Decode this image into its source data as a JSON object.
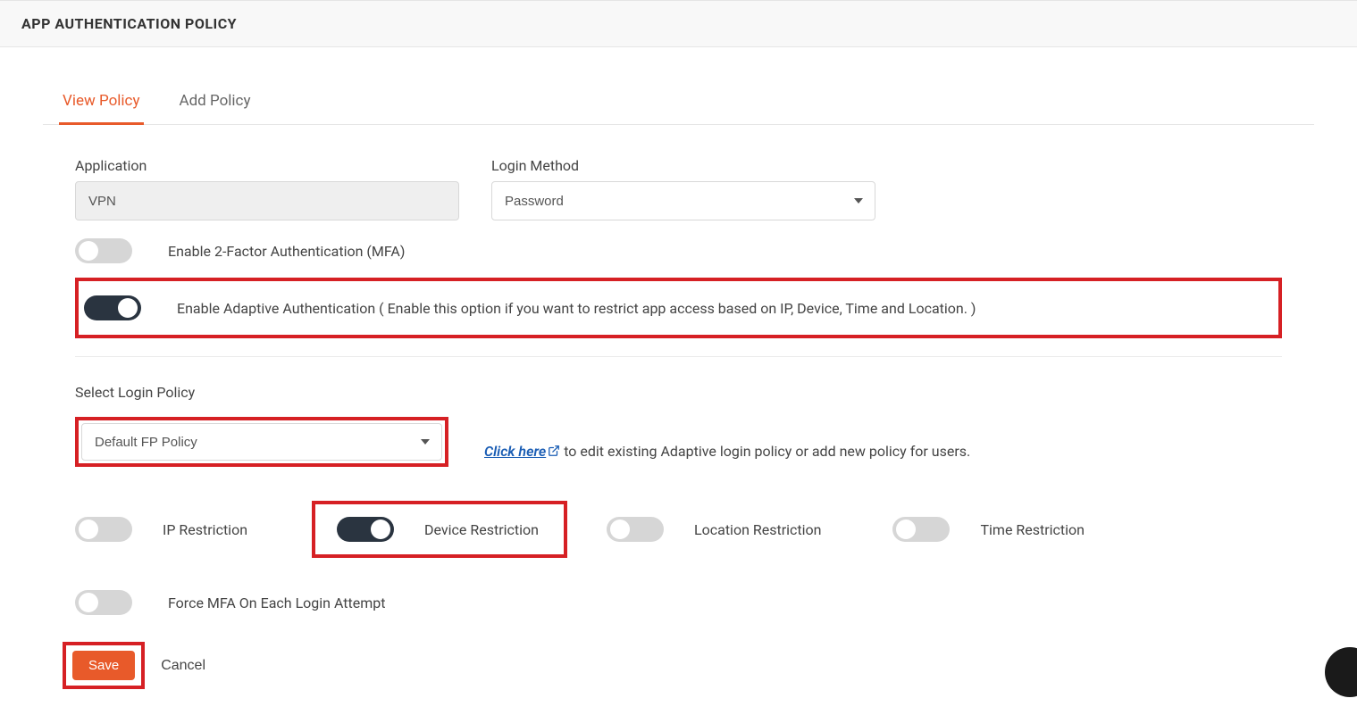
{
  "header": {
    "title": "APP AUTHENTICATION POLICY"
  },
  "tabs": {
    "view": "View Policy",
    "add": "Add Policy"
  },
  "fields": {
    "application_label": "Application",
    "application_value": "VPN",
    "login_method_label": "Login Method",
    "login_method_value": "Password",
    "mfa_toggle_label": "Enable 2-Factor Authentication (MFA)",
    "adaptive_toggle_label": "Enable Adaptive Authentication ( Enable this option if you want to restrict app access based on IP, Device, Time and Location. )",
    "select_login_policy_label": "Select Login Policy",
    "select_login_policy_value": "Default FP Policy",
    "click_here_link": "Click here",
    "click_here_rest": " to edit existing Adaptive login policy or add new policy for users."
  },
  "restrictions": {
    "ip": "IP Restriction",
    "device": "Device Restriction",
    "location": "Location Restriction",
    "time": "Time Restriction",
    "force_mfa": "Force MFA On Each Login Attempt"
  },
  "buttons": {
    "save": "Save",
    "cancel": "Cancel"
  }
}
